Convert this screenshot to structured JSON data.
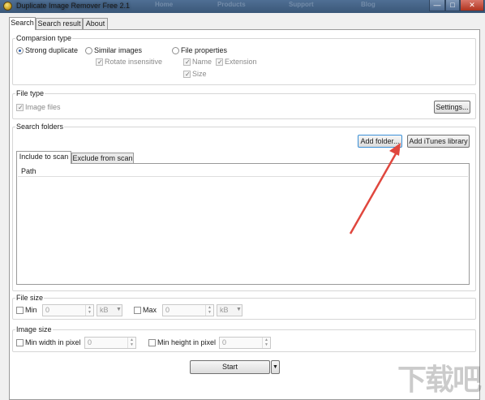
{
  "window": {
    "title": "Duplicate Image Remover Free 2.1",
    "header_links": [
      "Home",
      "Products",
      "Support",
      "Blog"
    ],
    "minimize_glyph": "—",
    "maximize_glyph": "□",
    "close_glyph": "✕"
  },
  "tabs": [
    "Search",
    "Search result",
    "About"
  ],
  "comparison": {
    "label": "Comparsion type",
    "strong": "Strong duplicate",
    "similar": "Similar images",
    "rotate": "Rotate insensitive",
    "file_props": "File properties",
    "name": "Name",
    "extension": "Extension",
    "size": "Size"
  },
  "file_type": {
    "label": "File type",
    "image_files": "Image files",
    "settings_button": "Settings..."
  },
  "search_folders": {
    "label": "Search folders",
    "add_folder": "Add folder...",
    "add_itunes": "Add iTunes library",
    "tab_include": "Include to scan",
    "tab_exclude": "Exclude from scan",
    "path_header": "Path"
  },
  "file_size": {
    "label": "File size",
    "min_label": "Min",
    "min_value": "0",
    "min_unit": "kB",
    "max_label": "Max",
    "max_value": "0",
    "max_unit": "kB"
  },
  "image_size": {
    "label": "Image size",
    "min_width_label": "Min width in pixel",
    "min_width_value": "0",
    "min_height_label": "Min height in pixel",
    "min_height_value": "0"
  },
  "start_button": "Start",
  "dropdown_glyph": "▼",
  "spin_up": "▲",
  "spin_down": "▼",
  "watermark": "下载吧",
  "annotation_color": "#e0473e"
}
